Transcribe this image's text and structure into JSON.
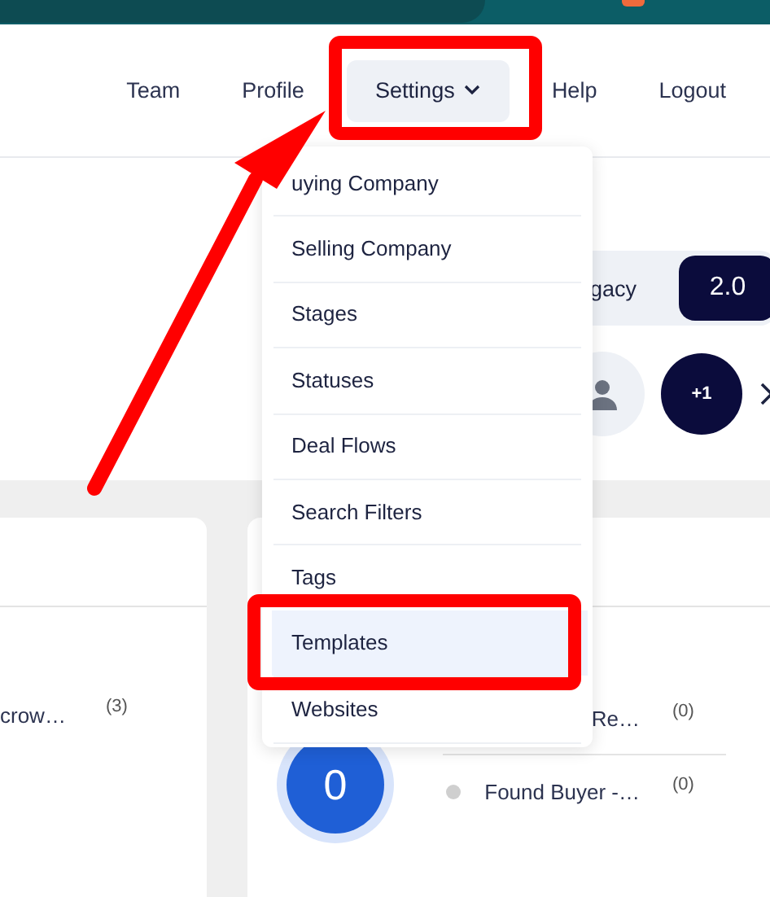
{
  "nav": [
    {
      "label": "Team",
      "kind": "link",
      "selected": false
    },
    {
      "label": "Profile",
      "kind": "link",
      "selected": false
    },
    {
      "label": "Settings",
      "kind": "dropdown",
      "selected": true
    },
    {
      "label": "Help",
      "kind": "link",
      "selected": false
    },
    {
      "label": "Logout",
      "kind": "link",
      "selected": false
    }
  ],
  "settings_menu": {
    "items": [
      {
        "label": "uying Company",
        "selected": false
      },
      {
        "label": "Selling Company",
        "selected": false
      },
      {
        "label": "Stages",
        "selected": false
      },
      {
        "label": "Statuses",
        "selected": false
      },
      {
        "label": "Deal Flows",
        "selected": false
      },
      {
        "label": "Search Filters",
        "selected": false
      },
      {
        "label": "Tags",
        "selected": false
      },
      {
        "label": "Templates",
        "selected": true
      },
      {
        "label": "Websites",
        "selected": false
      }
    ]
  },
  "view_toggle": {
    "options": [
      {
        "label": "gacy",
        "selected": false
      },
      {
        "label": "2.0",
        "selected": true
      }
    ]
  },
  "avatars": [
    {
      "kind": "placeholder"
    },
    {
      "kind": "count",
      "label": "+1"
    }
  ],
  "cards": [
    {
      "rows": [
        {
          "label": "crow…",
          "count": "(3)"
        }
      ]
    },
    {
      "total": "0",
      "rows": [
        {
          "label": "Re…",
          "count": "(0)"
        },
        {
          "label": "Found Buyer -…",
          "count": "(0)",
          "dot": true
        }
      ]
    }
  ]
}
